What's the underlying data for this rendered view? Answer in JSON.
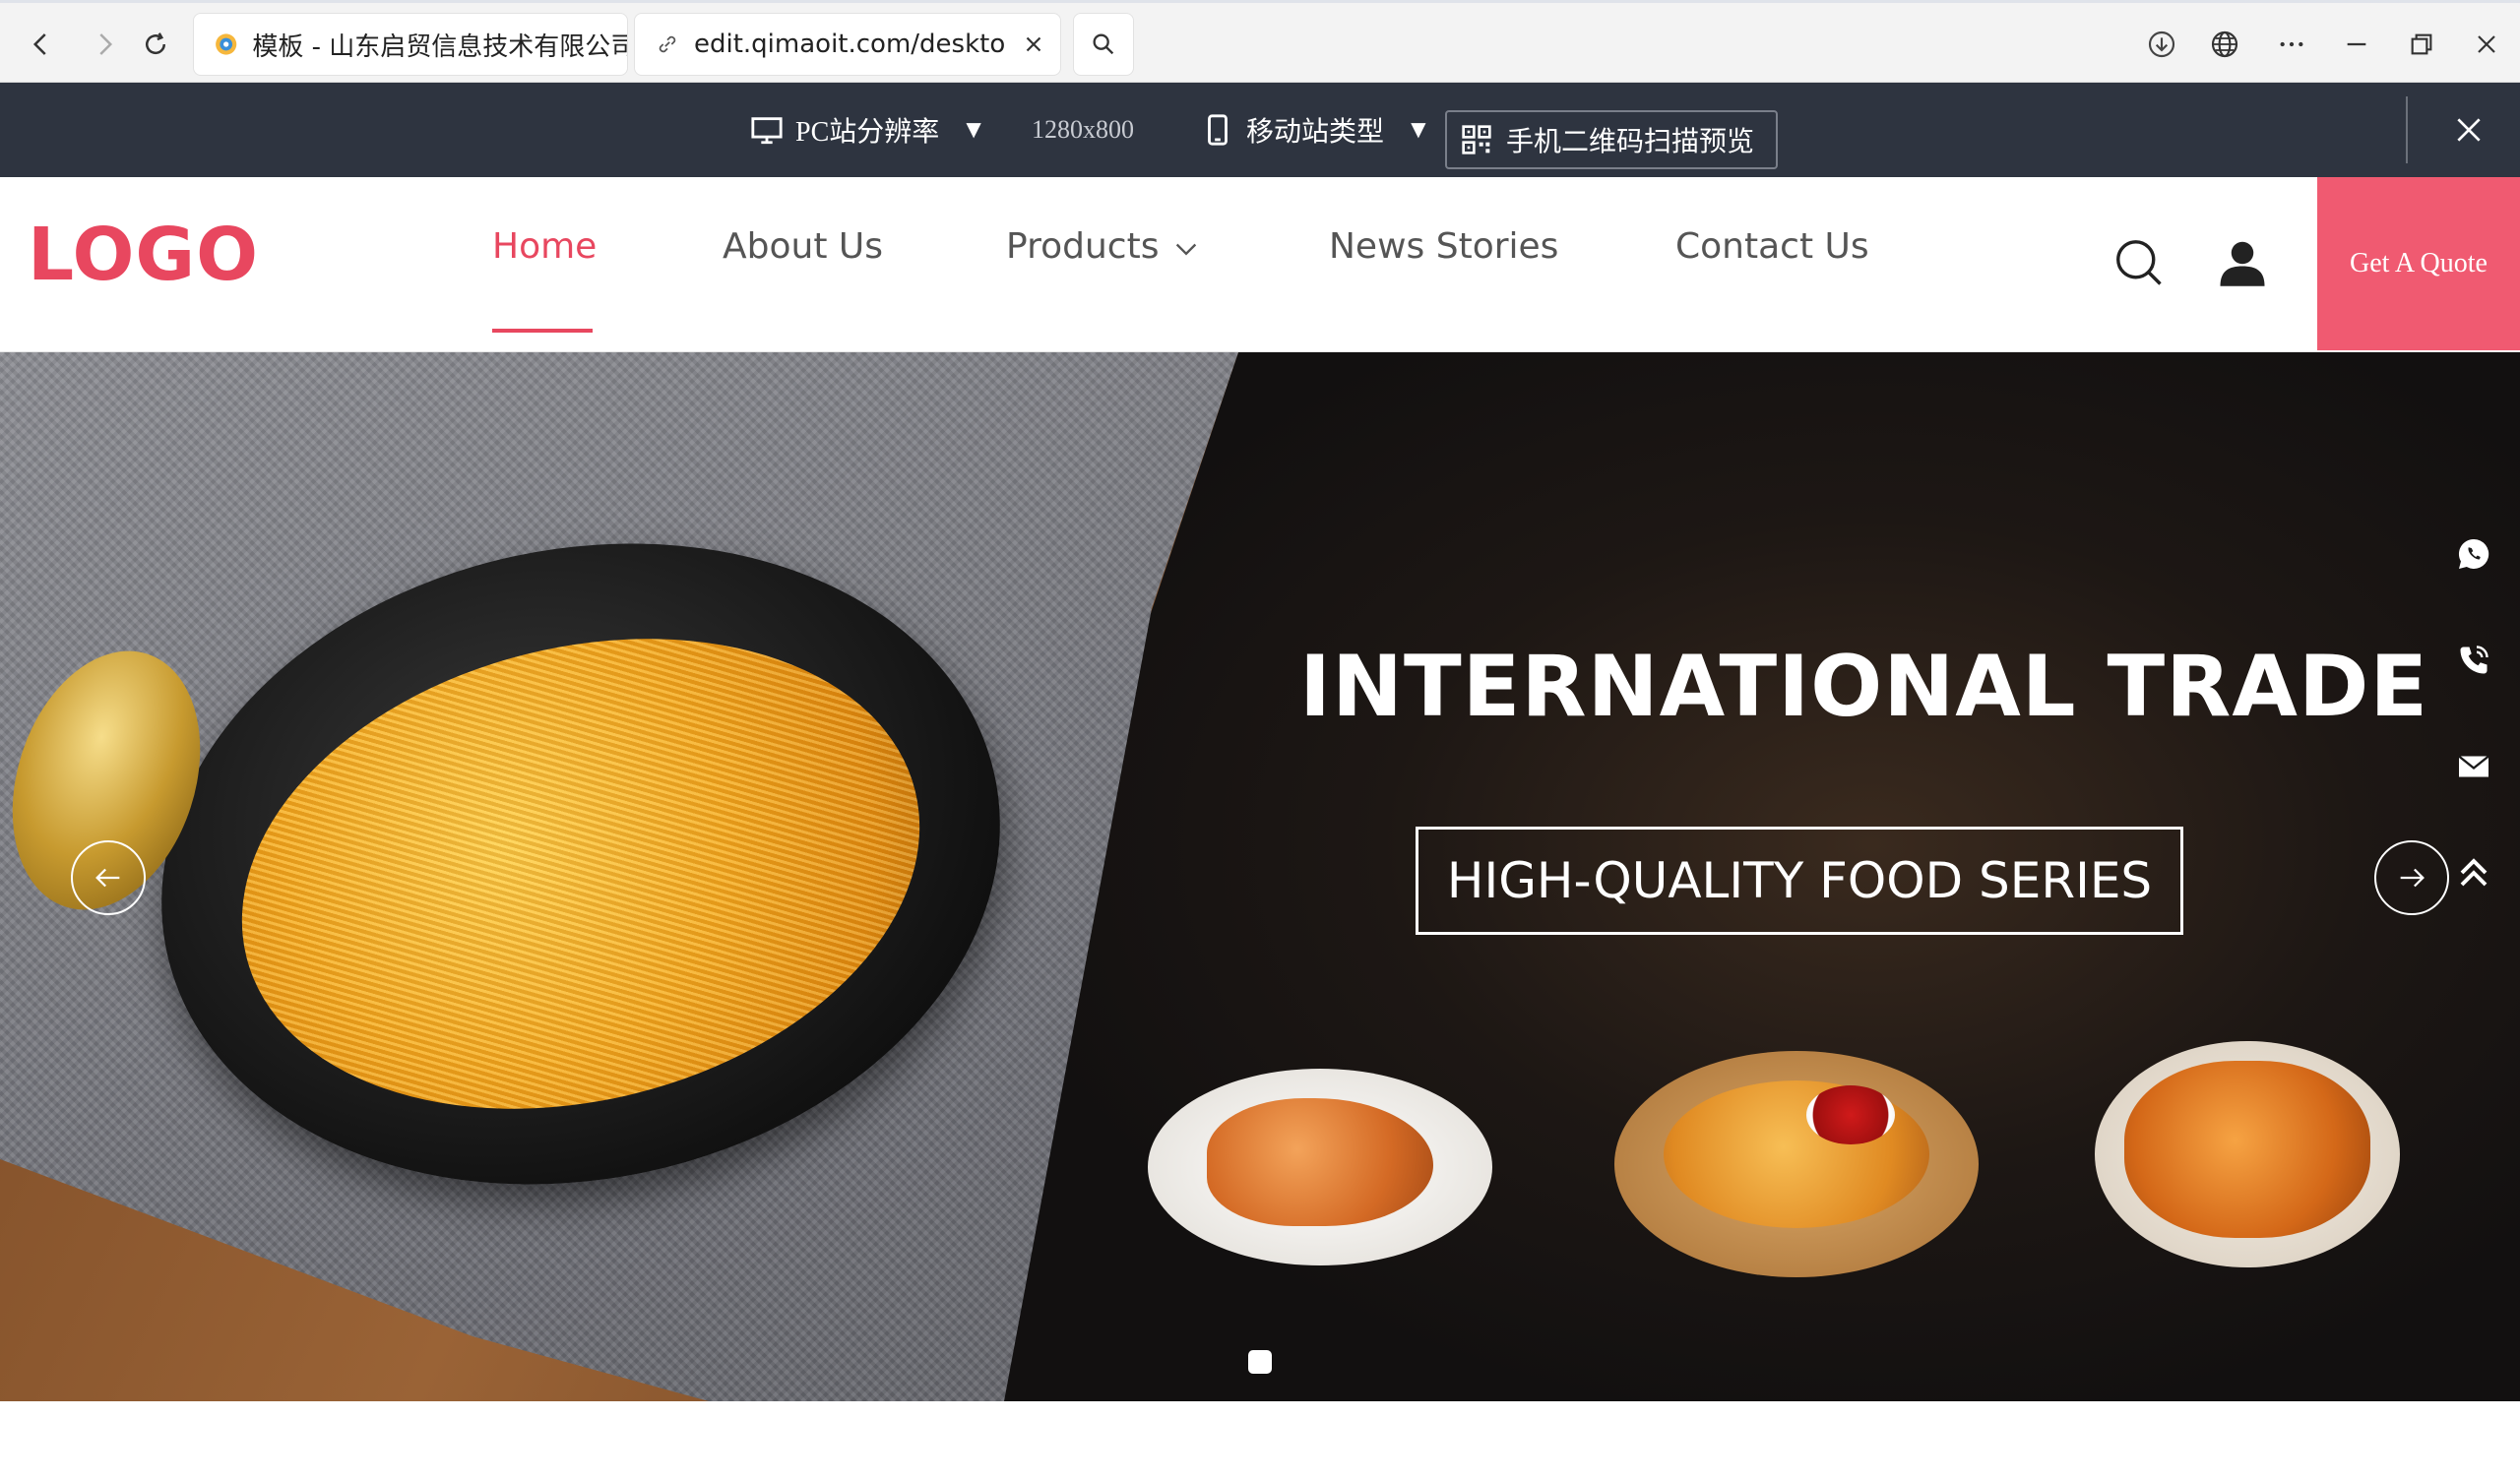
{
  "browser": {
    "tabs": [
      {
        "title": "模板 - 山东启贸信息技术有限公司",
        "active": false
      },
      {
        "title": "edit.qimaoit.com/desktop/h",
        "active": true
      }
    ],
    "icons": [
      "back-icon",
      "forward-icon",
      "refresh-icon",
      "search-icon",
      "download-icon",
      "globe-icon",
      "more-icon",
      "minimize-icon",
      "restore-icon",
      "close-icon"
    ]
  },
  "editor_bar": {
    "pc_resolution_label": "PC站分辨率",
    "resolution_value": "1280x800",
    "mobile_type_label": "移动站类型",
    "qr_preview_label": "手机二维码扫描预览",
    "caret": "▼"
  },
  "site": {
    "logo": "LOGO",
    "nav": [
      {
        "label": "Home",
        "active": true
      },
      {
        "label": "About Us",
        "active": false
      },
      {
        "label": "Products",
        "active": false,
        "has_dropdown": true
      },
      {
        "label": "News Stories",
        "active": false
      },
      {
        "label": "Contact Us",
        "active": false
      }
    ],
    "quote_button": "Get A Quote",
    "accent_color": "#e8475f"
  },
  "hero": {
    "title": "INTERNATIONAL TRADE",
    "subtitle": "HIGH-QUALITY FOOD SERIES",
    "slide_count": 1,
    "active_slide": 1
  },
  "floating_contact": [
    "whatsapp-icon",
    "phone-icon",
    "email-icon",
    "back-to-top-icon"
  ]
}
